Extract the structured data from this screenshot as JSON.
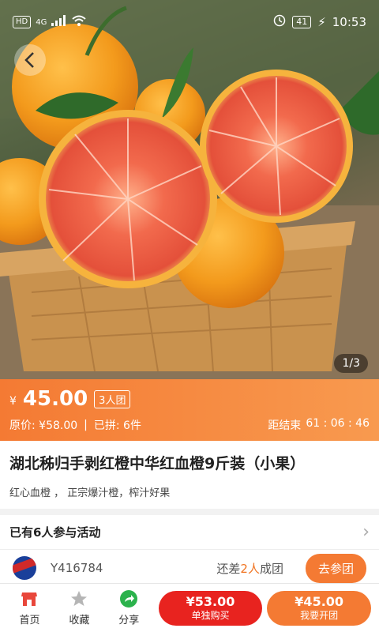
{
  "status_bar": {
    "network_hd": "HD",
    "network_4g": "4G",
    "battery": "41",
    "time": "10:53"
  },
  "gallery": {
    "counter": "1/3"
  },
  "price": {
    "currency": "¥",
    "current": "45.00",
    "group_tag": "3人团",
    "original_label": "原价: ¥58.00",
    "sold_label": "已拼: 6件",
    "countdown_label": "距结束",
    "countdown": "61 : 06 : 46"
  },
  "product": {
    "title": "湖北秭归手剥红橙中华红血橙9斤装（小果）",
    "subtitle": "红心血橙 ，  正宗爆汁橙，榨汁好果"
  },
  "participants": {
    "heading": "已有6人参与活动",
    "team": {
      "name": "Y416784",
      "need_prefix": "还差",
      "need_count": "2人",
      "need_suffix": "成团",
      "join_label": "去参团"
    }
  },
  "bottom_bar": {
    "home": "首页",
    "favorite": "收藏",
    "share": "分享",
    "solo_price": "¥53.00",
    "solo_label": "单独购买",
    "group_price": "¥45.00",
    "group_label": "我要开团"
  },
  "colors": {
    "accent": "#f47a33",
    "red": "#e8231f"
  }
}
